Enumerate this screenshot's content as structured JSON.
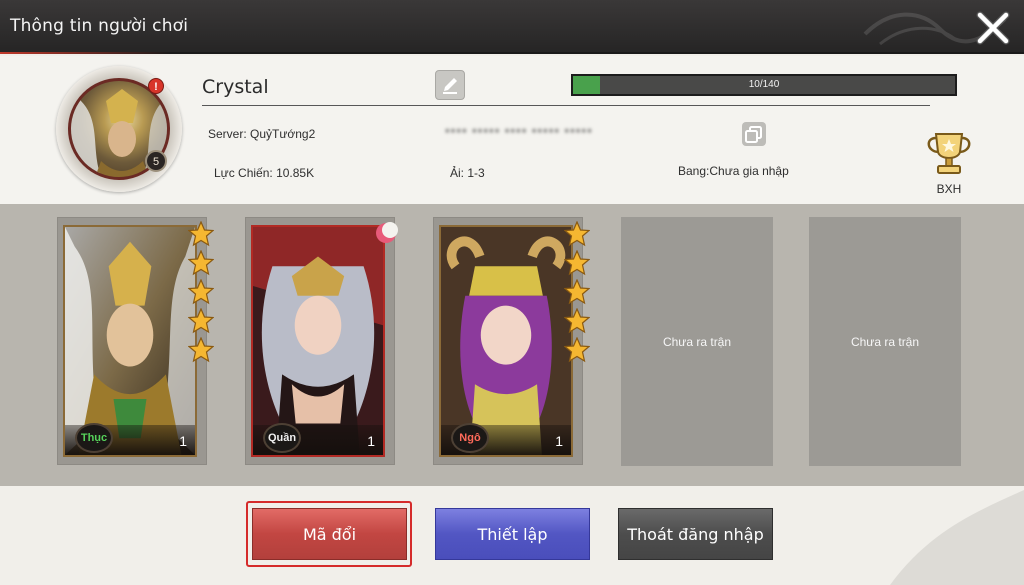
{
  "header": {
    "title": "Thông tin người chơi"
  },
  "profile": {
    "name": "Crystal",
    "level": "5",
    "alert": "!",
    "exp_text": "10/140",
    "exp_fraction": 0.0714,
    "server": "Server: QuỷTướng2",
    "power": "Lực Chiến: 10.85K",
    "stage": "Ải: 1-3",
    "guild": "Bang:Chưa gia nhập",
    "user_id": "**** ***** **** ***** *****",
    "rank_label": "BXH"
  },
  "lineup": {
    "heroes": [
      {
        "faction": "Thục",
        "faction_color": "#56d15a",
        "level": "1",
        "stars": 5,
        "frame": "gold"
      },
      {
        "faction": "Quần",
        "faction_color": "#f0f0f0",
        "level": "1",
        "stars": 0,
        "frame": "red"
      },
      {
        "faction": "Ngô",
        "faction_color": "#ff6a5a",
        "level": "1",
        "stars": 5,
        "frame": "gold"
      }
    ],
    "empty_slots": [
      "Chưa ra trận",
      "Chưa ra trận"
    ]
  },
  "actions": {
    "redeem_label": "Mã đổi",
    "settings_label": "Thiết lập",
    "logout_label": "Thoát đăng nhập"
  },
  "colors": {
    "exp_fill": "#49a14c",
    "redeem": "#c24642",
    "settings": "#5256c3",
    "logout": "#4d4d4d",
    "star": "#f5b731"
  }
}
